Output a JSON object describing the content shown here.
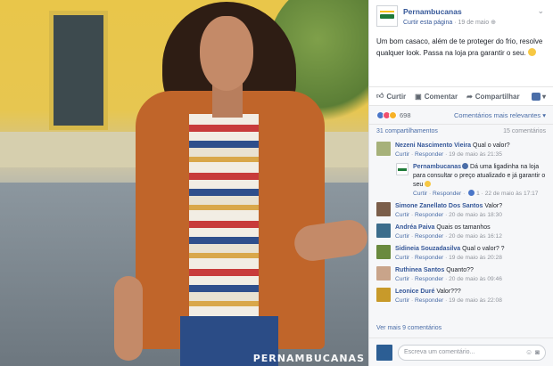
{
  "photo": {
    "watermark": "PERNAMBUCANAS"
  },
  "post": {
    "page_name": "Pernambucanas",
    "like_page": "Curtir esta página",
    "separator": " · ",
    "date": "19 de maio",
    "globe_icon": "globe-icon",
    "text": "Um bom casaco, além de te proteger do frio, resolve qualquer look. Passa na loja pra garantir o seu.",
    "emoji": "smile-emoji"
  },
  "actions": {
    "like": "Curtir",
    "comment": "Comentar",
    "share": "Compartilhar"
  },
  "reactions": {
    "count": "698",
    "relevant": "Comentários mais relevantes ▾"
  },
  "shares": {
    "shares_label": "31 compartilhamentos",
    "comments_label": "15 comentários"
  },
  "comments": [
    {
      "name": "Nezeni Nascimento Vieira",
      "text": "Qual o valor?",
      "curtir": "Curtir",
      "responder": "Responder",
      "time": "19 de maio às 21:35",
      "avatar_color": "#a6b17a"
    },
    {
      "name": "Simone Zanellato Dos Santos",
      "text": "Valor?",
      "curtir": "Curtir",
      "responder": "Responder",
      "time": "20 de maio às 18:30",
      "avatar_color": "#7b5e4a"
    },
    {
      "name": "Andréa Paiva",
      "text": "Quais os tamanhos",
      "curtir": "Curtir",
      "responder": "Responder",
      "time": "20 de maio às 16:12",
      "avatar_color": "#3c6d8c"
    },
    {
      "name": "Sidineia Souzadasilva",
      "text": "Qual o valor? ?",
      "curtir": "Curtir",
      "responder": "Responder",
      "time": "19 de maio às 20:28",
      "avatar_color": "#6a8a3e"
    },
    {
      "name": "Ruthinea Santos",
      "text": "Quanto??",
      "curtir": "Curtir",
      "responder": "Responder",
      "time": "20 de maio às 09:46",
      "avatar_color": "#c9a48a"
    },
    {
      "name": "Leonice Duré",
      "text": "Valor???",
      "curtir": "Curtir",
      "responder": "Responder",
      "time": "19 de maio às 22:08",
      "avatar_color": "#c89a2a"
    }
  ],
  "reply": {
    "name": "Pernambucanas",
    "text": "Dá uma ligadinha na loja para consultar o preço atualizado e já garantir o seu",
    "curtir": "Curtir",
    "responder": "Responder",
    "likes": "1",
    "time": "22 de maio às 17:17"
  },
  "more_comments": "Ver mais 9 comentários",
  "write": {
    "placeholder": "Escreva um comentário..."
  }
}
